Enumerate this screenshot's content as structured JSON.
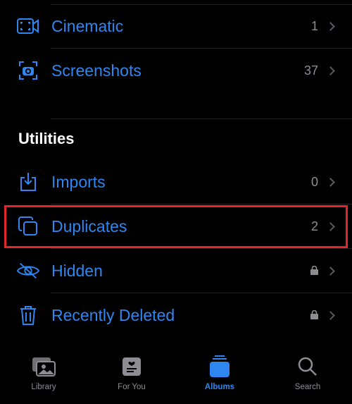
{
  "albums": [
    {
      "label": "Cinematic",
      "count": "1",
      "icon": "cinematic-icon"
    },
    {
      "label": "Screenshots",
      "count": "37",
      "icon": "screenshot-icon"
    }
  ],
  "utilities": {
    "heading": "Utilities",
    "items": [
      {
        "label": "Imports",
        "count": "0",
        "icon": "import-icon"
      },
      {
        "label": "Duplicates",
        "count": "2",
        "icon": "duplicate-icon",
        "highlighted": true
      },
      {
        "label": "Hidden",
        "count": "",
        "icon": "eye-slash-icon",
        "locked": true
      },
      {
        "label": "Recently Deleted",
        "count": "",
        "icon": "trash-icon",
        "locked": true
      }
    ]
  },
  "tabs": [
    {
      "label": "Library"
    },
    {
      "label": "For You"
    },
    {
      "label": "Albums",
      "active": true
    },
    {
      "label": "Search"
    }
  ],
  "colors": {
    "accent": "#2f86f0",
    "highlight": "#e0262a"
  }
}
